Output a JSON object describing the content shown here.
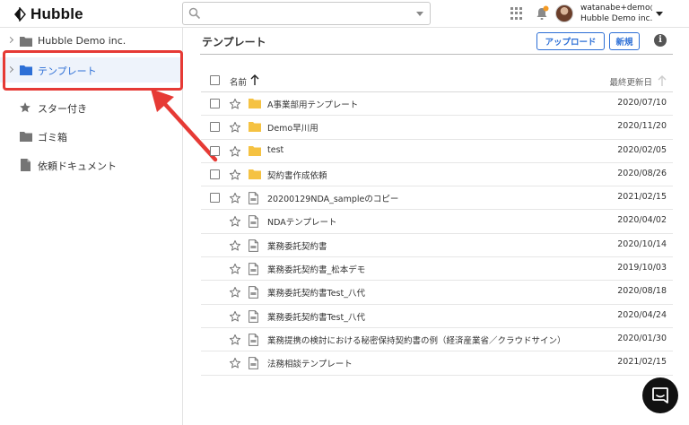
{
  "header": {
    "logo_text": "Hubble",
    "search": {
      "placeholder": "",
      "value": ""
    },
    "user": {
      "email": "watanabe+demo@h...",
      "org": "Hubble Demo inc."
    }
  },
  "sidebar": {
    "items": [
      {
        "label": "Hubble Demo inc.",
        "icon": "folder-icon",
        "expandable": true,
        "active": false
      },
      {
        "label": "テンプレート",
        "icon": "folder-icon",
        "expandable": true,
        "active": true
      },
      {
        "label": "スター付き",
        "icon": "star-icon",
        "expandable": false,
        "active": false
      },
      {
        "label": "ゴミ箱",
        "icon": "folder-icon",
        "expandable": false,
        "active": false
      },
      {
        "label": "依頼ドキュメント",
        "icon": "document-icon",
        "expandable": false,
        "active": false
      }
    ]
  },
  "main": {
    "title": "テンプレート",
    "upload_label": "アップロード",
    "new_label": "新規",
    "info_glyph": "i",
    "table": {
      "col_name": "名前",
      "col_date": "最終更新日",
      "rows": [
        {
          "name": "A事業部用テンプレート",
          "date": "2020/07/10",
          "type": "folder",
          "checkbox": true
        },
        {
          "name": "Demo早川用",
          "date": "2020/11/20",
          "type": "folder",
          "checkbox": true
        },
        {
          "name": "test",
          "date": "2020/02/05",
          "type": "folder",
          "checkbox": true
        },
        {
          "name": "契約書作成依頼",
          "date": "2020/08/26",
          "type": "folder",
          "checkbox": true
        },
        {
          "name": "20200129NDA_sampleのコピー",
          "date": "2021/02/15",
          "type": "file",
          "checkbox": true
        },
        {
          "name": "NDAテンプレート",
          "date": "2020/04/02",
          "type": "file",
          "checkbox": false
        },
        {
          "name": "業務委託契約書",
          "date": "2020/10/14",
          "type": "file",
          "checkbox": false
        },
        {
          "name": "業務委託契約書_松本デモ",
          "date": "2019/10/03",
          "type": "file",
          "checkbox": false
        },
        {
          "name": "業務委託契約書Test_八代",
          "date": "2020/08/18",
          "type": "file",
          "checkbox": false
        },
        {
          "name": "業務委託契約書Test_八代",
          "date": "2020/04/24",
          "type": "file",
          "checkbox": false
        },
        {
          "name": "業務提携の検討における秘密保持契約書の例（経済産業省／クラウドサイン）",
          "date": "2020/01/30",
          "type": "file",
          "checkbox": false
        },
        {
          "name": "法務相談テンプレート",
          "date": "2021/02/15",
          "type": "file",
          "checkbox": false
        }
      ]
    }
  },
  "colors": {
    "accent": "#2d6fd6",
    "folder": "#f5c242",
    "highlight": "#e63a35",
    "notification": "#f59a23"
  }
}
